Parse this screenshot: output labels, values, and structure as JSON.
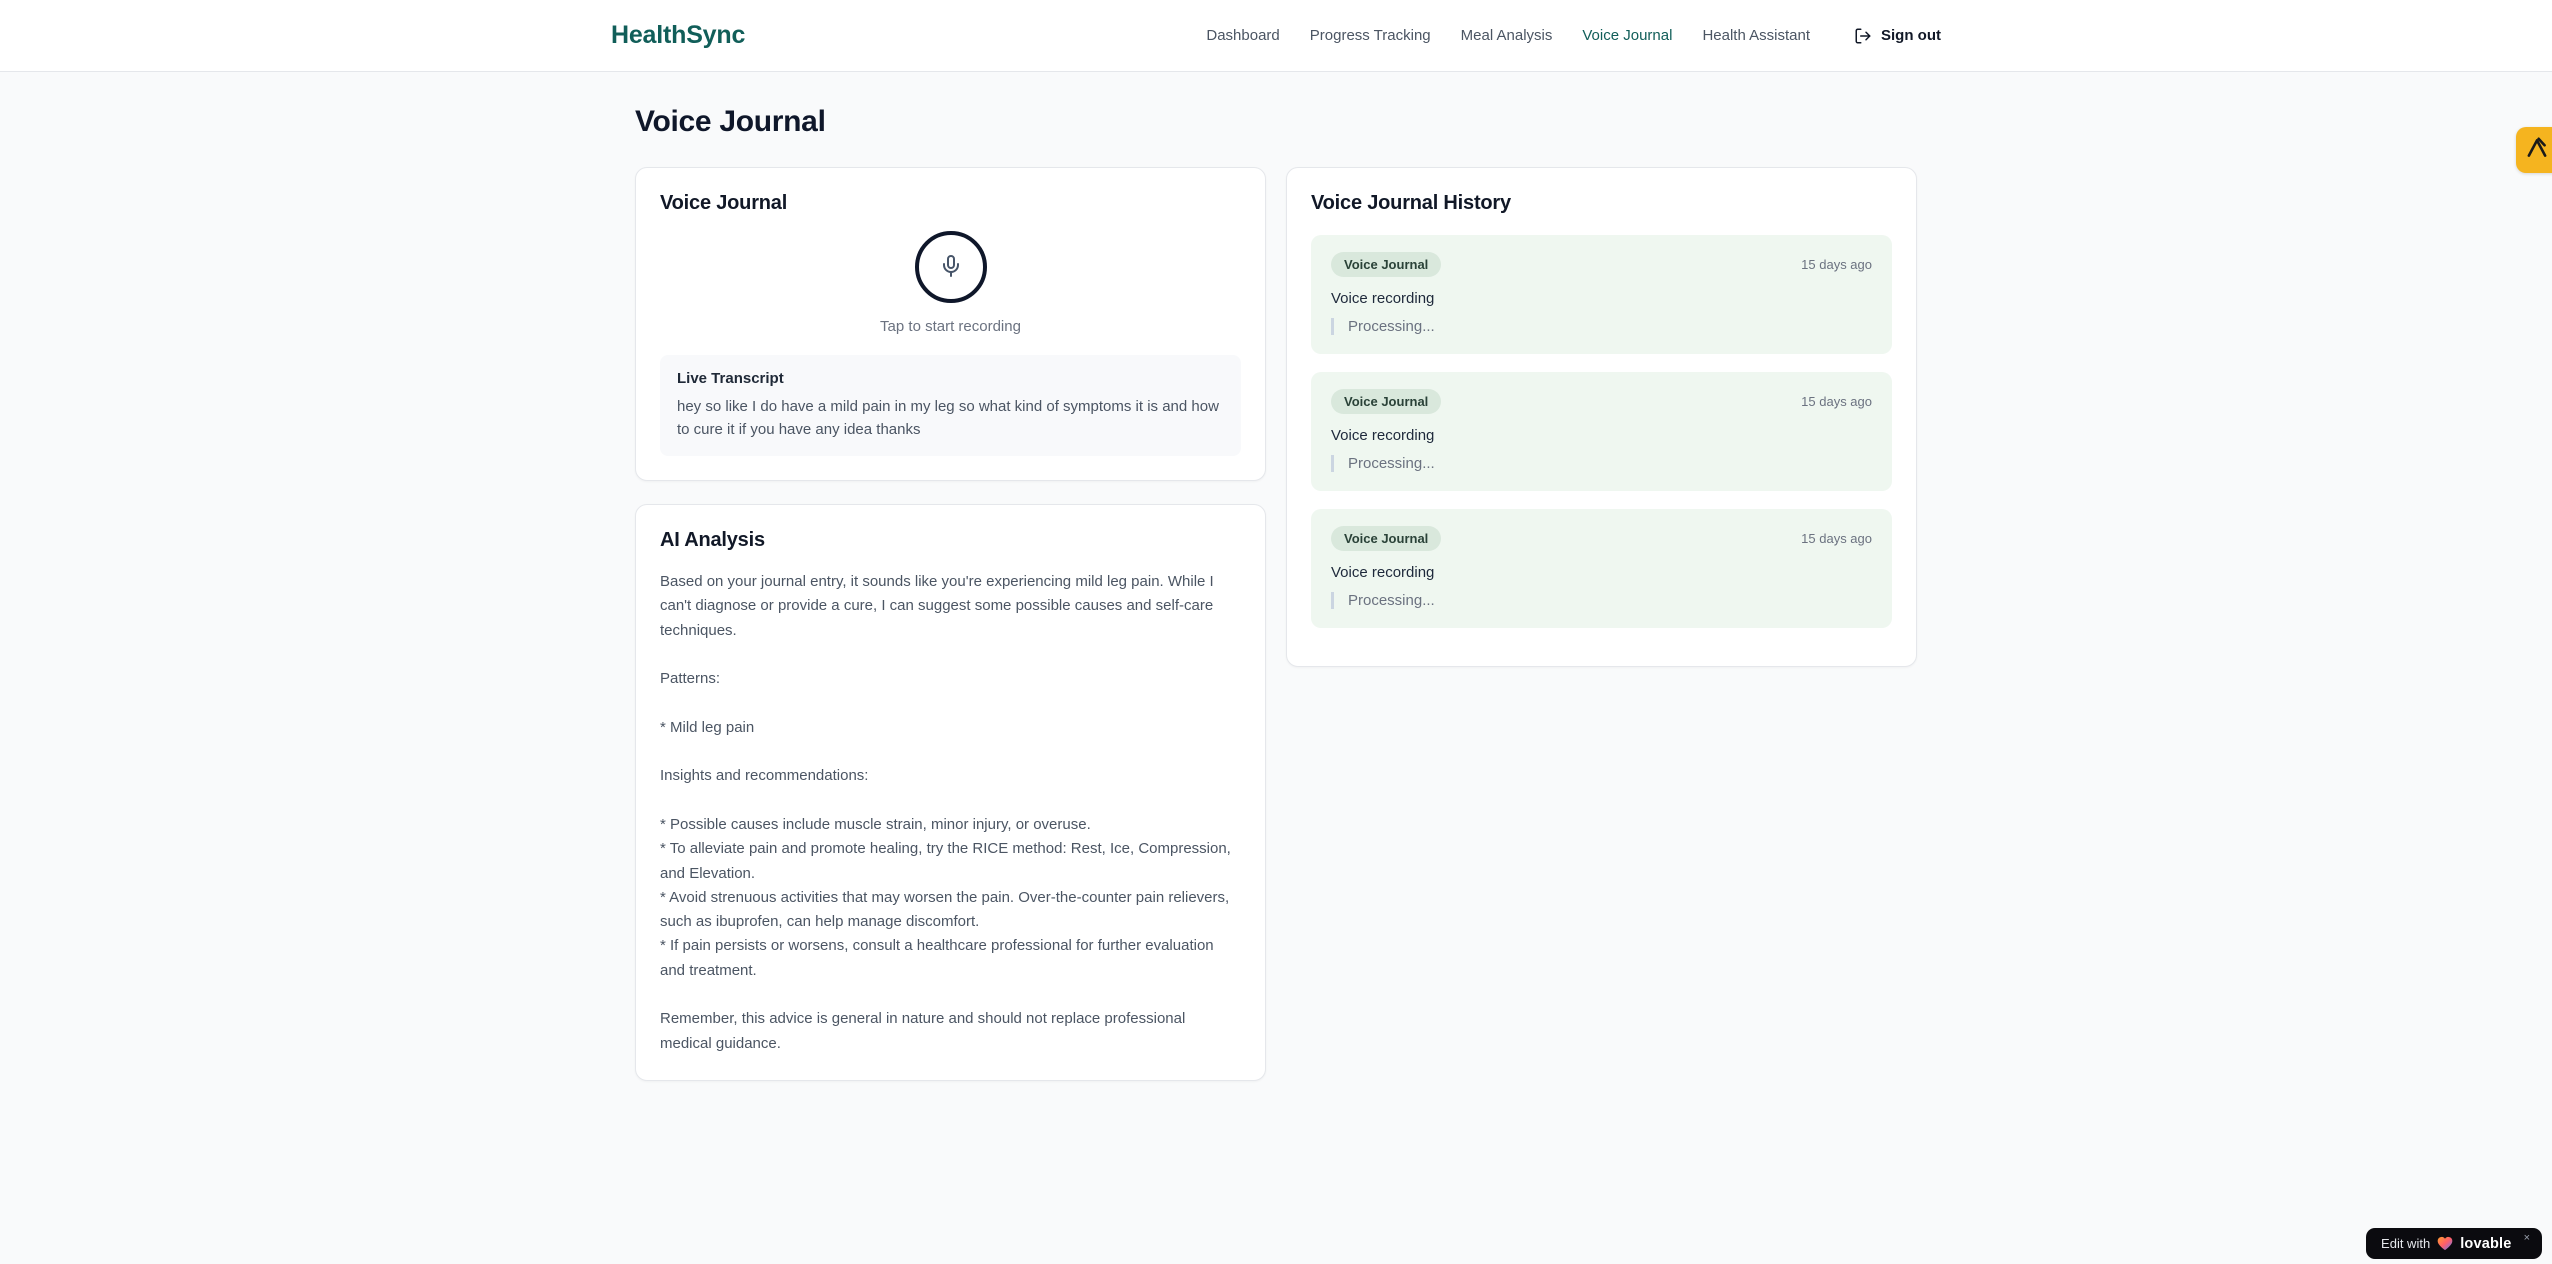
{
  "brand": {
    "name": "HealthSync"
  },
  "nav": {
    "items": [
      {
        "label": "Dashboard",
        "active": false
      },
      {
        "label": "Progress Tracking",
        "active": false
      },
      {
        "label": "Meal Analysis",
        "active": false
      },
      {
        "label": "Voice Journal",
        "active": true
      },
      {
        "label": "Health Assistant",
        "active": false
      }
    ],
    "sign_out_label": "Sign out"
  },
  "page": {
    "title": "Voice Journal"
  },
  "recorder": {
    "card_title": "Voice Journal",
    "tap_hint": "Tap to start recording",
    "transcript_title": "Live Transcript",
    "transcript_text": "hey so like I do have a mild pain in my leg so what kind of symptoms it is and how to cure it if you have any idea thanks"
  },
  "analysis": {
    "card_title": "AI Analysis",
    "body": "Based on your journal entry, it sounds like you're experiencing mild leg pain. While I can't diagnose or provide a cure, I can suggest some possible causes and self-care techniques.\n\nPatterns:\n\n* Mild leg pain\n\nInsights and recommendations:\n\n* Possible causes include muscle strain, minor injury, or overuse.\n* To alleviate pain and promote healing, try the RICE method: Rest, Ice, Compression, and Elevation.\n* Avoid strenuous activities that may worsen the pain. Over-the-counter pain relievers, such as ibuprofen, can help manage discomfort.\n* If pain persists or worsens, consult a healthcare professional for further evaluation and treatment.\n\nRemember, this advice is general in nature and should not replace professional medical guidance."
  },
  "history": {
    "card_title": "Voice Journal History",
    "entries": [
      {
        "badge": "Voice Journal",
        "time": "15 days ago",
        "title": "Voice recording",
        "status": "Processing..."
      },
      {
        "badge": "Voice Journal",
        "time": "15 days ago",
        "title": "Voice recording",
        "status": "Processing..."
      },
      {
        "badge": "Voice Journal",
        "time": "15 days ago",
        "title": "Voice recording",
        "status": "Processing..."
      }
    ]
  },
  "overlays": {
    "edit_badge": {
      "prefix": "Edit with",
      "brand": "lovable",
      "close": "×"
    }
  },
  "colors": {
    "brand_teal": "#115e59",
    "page_background": "#f9fafb",
    "history_entry_background": "#eff7f0",
    "badge_background": "#d9e8dc",
    "side_badge_amber": "#f5b41f",
    "edit_badge_black": "#0b0b0f"
  }
}
